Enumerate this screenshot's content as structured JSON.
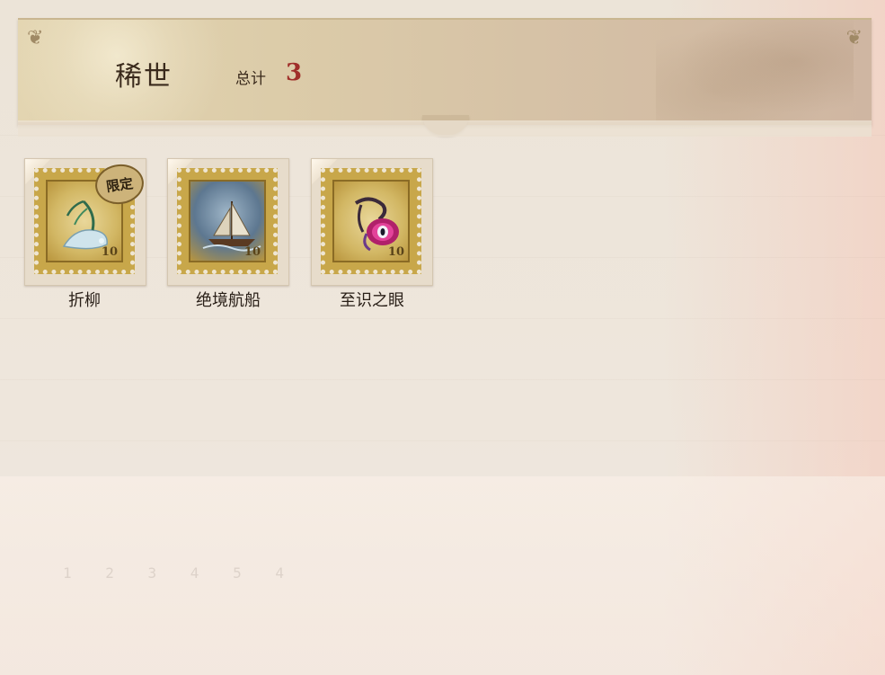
{
  "header": {
    "title": "稀世",
    "total_label": "总计",
    "total_count": "3"
  },
  "items": [
    {
      "name": "折柳",
      "badge": "限定",
      "stamp_value": "10",
      "art_icon": "willow-vase-icon"
    },
    {
      "name": "绝境航船",
      "badge": "",
      "stamp_value": "10",
      "art_icon": "sailing-ship-icon"
    },
    {
      "name": "至识之眼",
      "badge": "",
      "stamp_value": "10",
      "art_icon": "eye-amulet-icon"
    }
  ],
  "background_numbers": "1 2 3 4 5 4",
  "colors": {
    "count": "#a02f2a",
    "stamp_gold": "#c8a74a",
    "banner": "#dccca9"
  }
}
